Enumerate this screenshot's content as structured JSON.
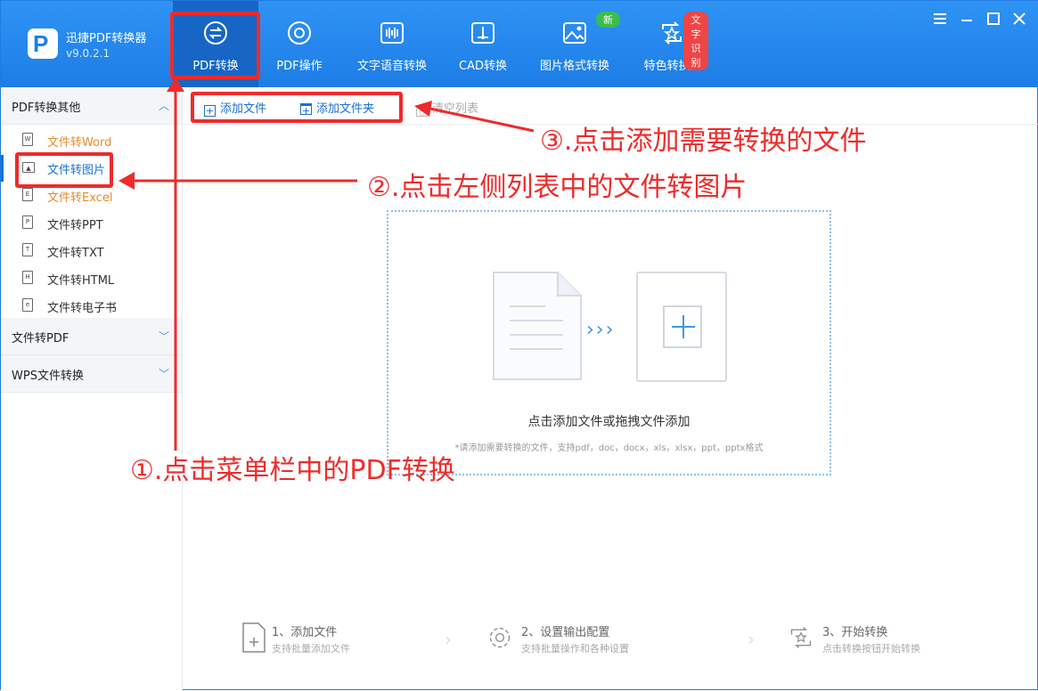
{
  "app": {
    "name": "迅捷PDF转换器",
    "version": "v9.0.2.1"
  },
  "nav": [
    {
      "label": "PDF转换",
      "icon": "convert-icon",
      "active": true
    },
    {
      "label": "PDF操作",
      "icon": "gear-icon"
    },
    {
      "label": "文字语音转换",
      "icon": "audio-icon"
    },
    {
      "label": "CAD转换",
      "icon": "cad-icon"
    },
    {
      "label": "图片格式转换",
      "icon": "image-icon",
      "badge": "新"
    },
    {
      "label": "特色转换",
      "icon": "star-icon",
      "badge": "文字识别"
    }
  ],
  "sidebar": {
    "section1": "PDF转换其他",
    "items": [
      {
        "label": "文件转Word",
        "icon": "W"
      },
      {
        "label": "文件转图片",
        "icon": "img"
      },
      {
        "label": "文件转Excel",
        "icon": "E"
      },
      {
        "label": "文件转PPT",
        "icon": "P"
      },
      {
        "label": "文件转TXT",
        "icon": "T"
      },
      {
        "label": "文件转HTML",
        "icon": "H"
      },
      {
        "label": "文件转电子书",
        "icon": "e"
      }
    ],
    "section2": "文件转PDF",
    "section3": "WPS文件转换"
  },
  "toolbar": {
    "add_file": "添加文件",
    "add_folder": "添加文件夹",
    "clear": "清空列表"
  },
  "dropzone": {
    "main": "点击添加文件或拖拽文件添加",
    "hint": "*请添加需要转换的文件，支持pdf，doc，docx，xls，xlsx，ppt，pptx格式"
  },
  "steps": [
    {
      "title": "1、添加文件",
      "desc": "支持批量添加文件"
    },
    {
      "title": "2、设置输出配置",
      "desc": "支持批量操作和各种设置"
    },
    {
      "title": "3、开始转换",
      "desc": "点击转换按钮开始转换"
    }
  ],
  "annotations": {
    "a1": "①.点击菜单栏中的PDF转换",
    "a2": "②.点击左侧列表中的文件转图片",
    "a3": "③.点击添加需要转换的文件"
  },
  "colors": {
    "accent": "#1d7de6",
    "annotation": "#ee2b2b"
  }
}
